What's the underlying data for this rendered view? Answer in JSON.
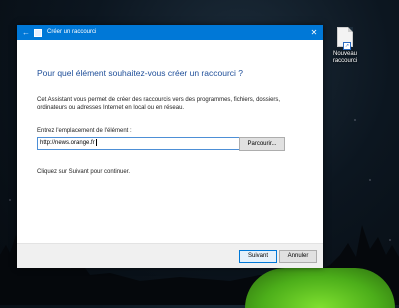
{
  "desktop": {
    "shortcut_icon": {
      "icon": "new-shortcut-icon",
      "label": "Nouveau raccourci"
    }
  },
  "dialog": {
    "title": "Créer un raccourci",
    "close_glyph": "✕",
    "back_glyph": "←",
    "heading": "Pour quel élément souhaitez-vous créer un raccourci ?",
    "intro": "Cet Assistant vous permet de créer des raccourcis vers des programmes, fichiers, dossiers, ordinateurs ou adresses Internet en local ou en réseau.",
    "location_label": "Entrez l'emplacement de l'élément :",
    "location_value": "http://news.orange.fr",
    "browse_label": "Parcourir...",
    "hint": "Cliquez sur Suivant pour continuer.",
    "next_label": "Suivant",
    "cancel_label": "Annuler",
    "accent_color": "#0078d7",
    "heading_color": "#1e4e99"
  }
}
